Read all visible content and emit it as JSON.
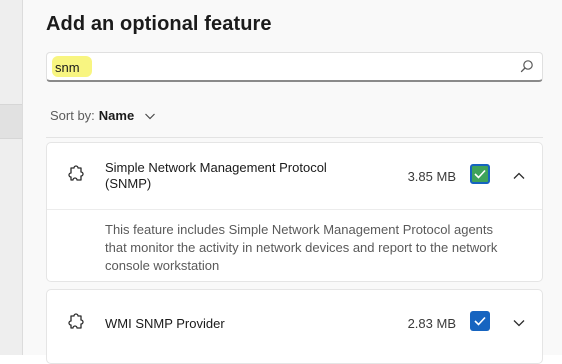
{
  "dialog": {
    "title": "Add an optional feature"
  },
  "search": {
    "value": "snm",
    "placeholder": "",
    "highlight_color": "#f7f36b"
  },
  "sort": {
    "label": "Sort by:",
    "value": "Name"
  },
  "features": [
    {
      "name": "Simple Network Management Protocol (SNMP)",
      "size": "3.85 MB",
      "checked": true,
      "expanded": true,
      "description": "This feature includes Simple Network Management Protocol agents that monitor the activity in network devices and report to the network console workstation",
      "icon": "puzzle-piece-icon"
    },
    {
      "name": "WMI SNMP Provider",
      "size": "2.83 MB",
      "checked": true,
      "expanded": false,
      "icon": "puzzle-piece-icon"
    }
  ],
  "colors": {
    "accent": "#1664c0",
    "checkbox_highlight": "#3ea35a"
  }
}
